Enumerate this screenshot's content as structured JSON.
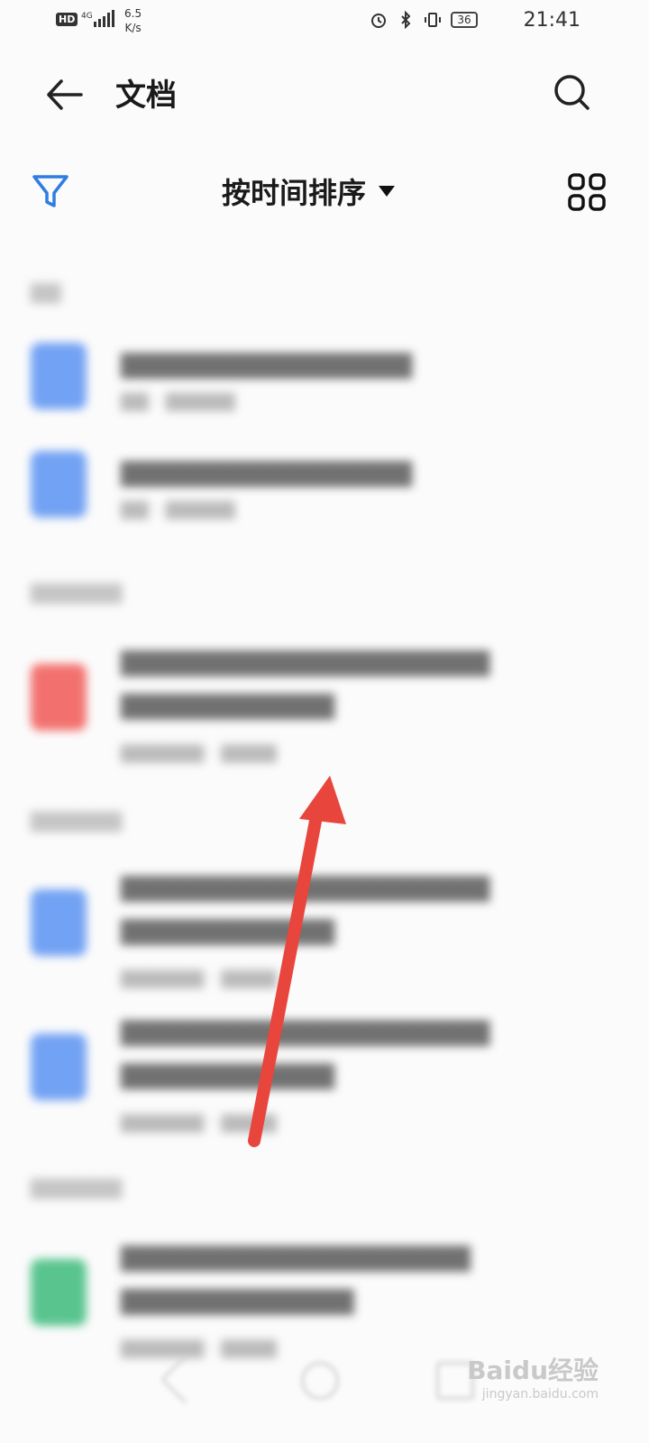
{
  "status_bar": {
    "hd_label": "HD",
    "network": "4G",
    "speed_value": "6.5",
    "speed_unit": "K/s",
    "battery": "36",
    "time": "21:41",
    "icons": [
      "alarm-icon",
      "bluetooth-icon",
      "vibrate-icon"
    ]
  },
  "header": {
    "title": "文档"
  },
  "toolbar": {
    "sort_label": "按时间排序"
  },
  "watermark": {
    "logo": "Baidu经验",
    "url": "jingyan.baidu.com"
  },
  "colors": {
    "accent": "#2f7de1",
    "doc_icon": "#5b93f3",
    "pdf_icon": "#f15a57",
    "xls_icon": "#3dbb7c",
    "arrow": "#e8453c"
  }
}
